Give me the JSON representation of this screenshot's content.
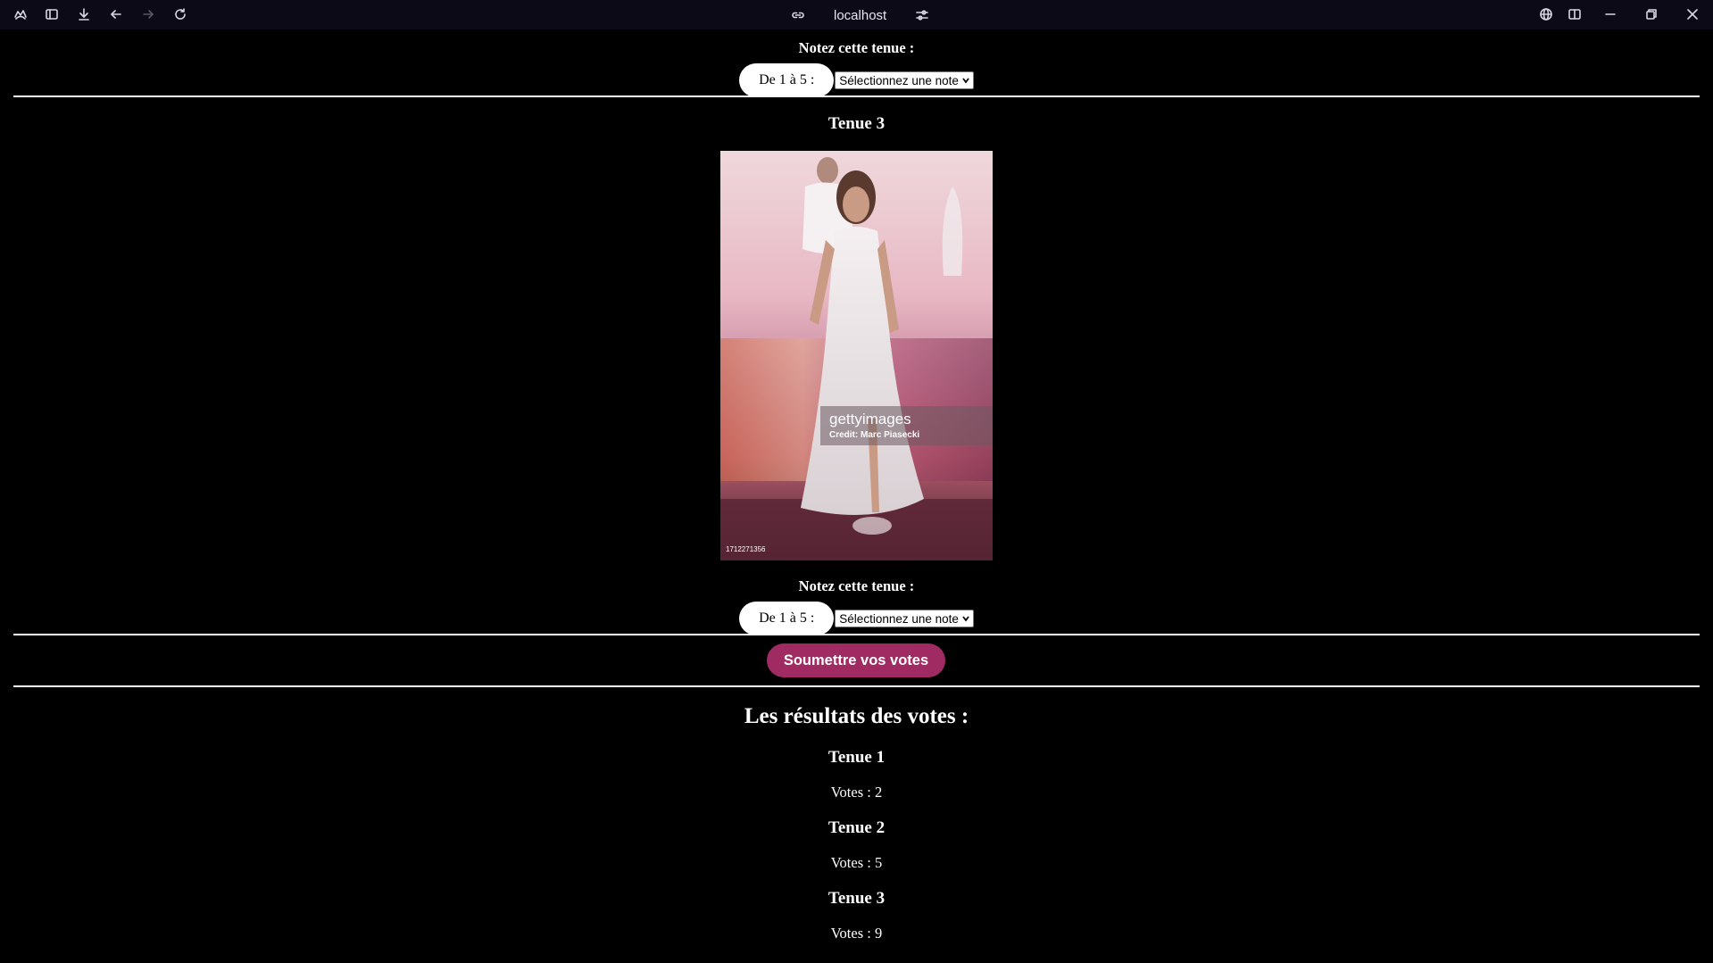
{
  "browser": {
    "address": "localhost",
    "icons": [
      "app-logo-icon",
      "sidebar-icon",
      "download-icon",
      "back-icon",
      "forward-icon",
      "reload-icon",
      "link-icon",
      "site-settings-icon",
      "globe-icon",
      "split-view-icon",
      "minimize-icon",
      "restore-icon",
      "close-icon"
    ]
  },
  "top_rating": {
    "label": "Notez cette tenue :",
    "range": "De 1 à 5 :",
    "select_value": "Sélectionnez une note"
  },
  "outfit3": {
    "title": "Tenue 3",
    "image": {
      "watermark_brand": "gettyimages",
      "watermark_credit": "Credit: Marc Piasecki",
      "image_number": "1712271356"
    },
    "rating_label": "Notez cette tenue :",
    "range": "De 1 à 5 :",
    "select_value": "Sélectionnez une note"
  },
  "submit_label": "Soumettre vos votes",
  "results": {
    "title": "Les résultats des votes :",
    "items": [
      {
        "name": "Tenue 1",
        "votes": "Votes : 2"
      },
      {
        "name": "Tenue 2",
        "votes": "Votes : 5"
      },
      {
        "name": "Tenue 3",
        "votes": "Votes : 9"
      }
    ]
  },
  "colors": {
    "page_bg": "#000000",
    "chrome_bg": "#0d0a17",
    "submit_bg": "#a02a62",
    "text": "#ffffff"
  }
}
